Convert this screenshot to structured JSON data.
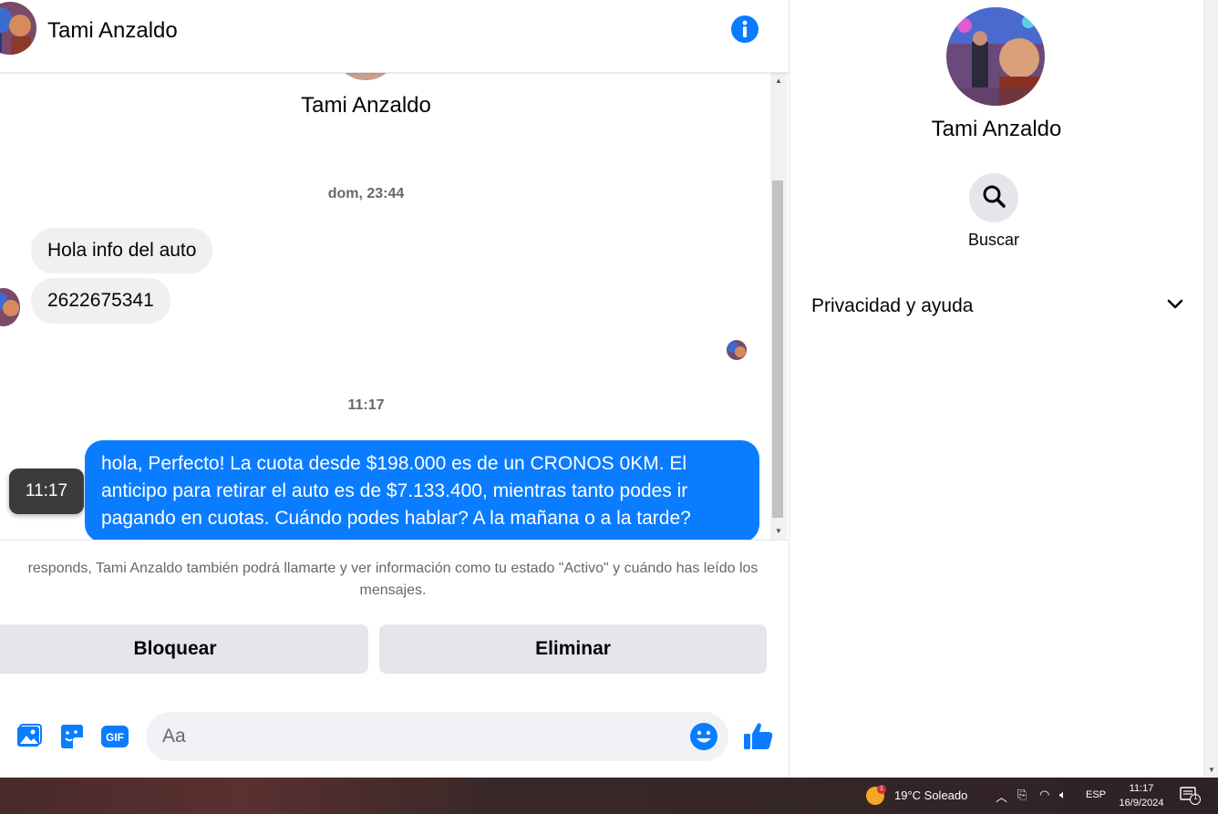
{
  "header": {
    "name": "Tami Anzaldo"
  },
  "conversation": {
    "profile_name": "Tami Anzaldo",
    "timestamp_1": "dom, 23:44",
    "incoming": [
      "Hola info del auto",
      "2622675341"
    ],
    "timestamp_2": "11:17",
    "outgoing": "hola, Perfecto! La cuota desde $198.000 es de un CRONOS 0KM. El anticipo para retirar el auto es de $7.133.400, mientras tanto podes ir pagando en cuotas. Cuándo podes hablar? A la mañana o a la tarde?",
    "tooltip_time": "11:17"
  },
  "notice": "responds, Tami Anzaldo también podrá llamarte y ver información como tu estado \"Activo\" y cuándo has leído los mensajes.",
  "actions": {
    "block": "Bloquear",
    "delete": "Eliminar"
  },
  "composer": {
    "placeholder": "Aa"
  },
  "sidebar": {
    "name": "Tami Anzaldo",
    "search_label": "Buscar",
    "privacy_label": "Privacidad y ayuda"
  },
  "taskbar": {
    "weather": "19°C  Soleado",
    "weather_badge": "1",
    "language": "ESP",
    "time": "11:17",
    "date": "16/9/2024",
    "notification_count": "1"
  },
  "colors": {
    "accent": "#0a7cff",
    "bubble_in": "#f0f0f0",
    "button_gray": "#e4e6eb"
  },
  "icons": [
    "info-icon",
    "photo-icon",
    "sticker-icon",
    "gif-icon",
    "emoji-icon",
    "like-icon",
    "search-icon",
    "chevron-down-icon"
  ]
}
